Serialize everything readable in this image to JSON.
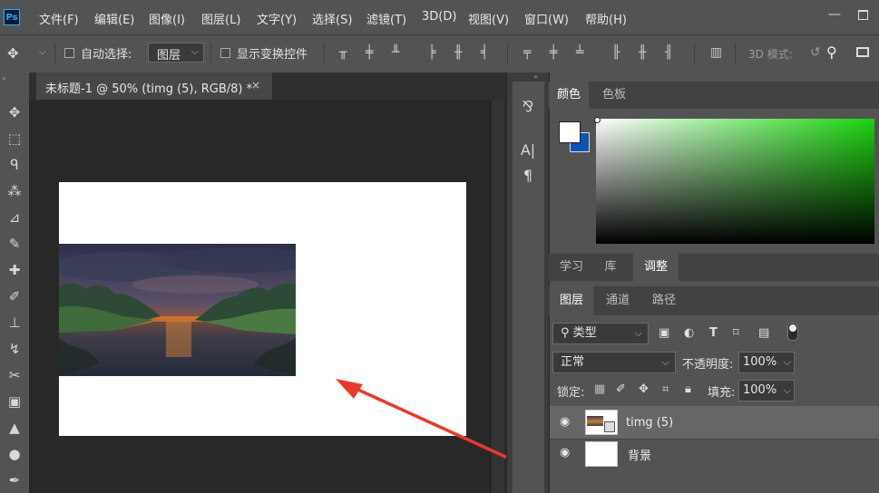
{
  "app": {
    "logo": "Ps"
  },
  "menu": [
    "文件(F)",
    "编辑(E)",
    "图像(I)",
    "图层(L)",
    "文字(Y)",
    "选择(S)",
    "滤镜(T)",
    "3D(D)",
    "视图(V)",
    "窗口(W)",
    "帮助(H)"
  ],
  "window_controls": {
    "minimize": "—"
  },
  "options_bar": {
    "auto_select_label": "自动选择:",
    "auto_select_value": "图层",
    "show_transform_label": "显示变换控件",
    "mode_3d_label": "3D 模式:"
  },
  "document": {
    "tab_title": "未标题-1 @ 50% (timg (5), RGB/8) *",
    "close": "×"
  },
  "color_panel": {
    "tabs": [
      "颜色",
      "色板"
    ],
    "foreground": "#ffffff",
    "background": "#0a54b4"
  },
  "adjust_panel": {
    "tabs": [
      "学习",
      "库",
      "调整"
    ]
  },
  "layers_panel": {
    "tabs": [
      "图层",
      "通道",
      "路径"
    ],
    "filter_label": "类型",
    "blend_mode": "正常",
    "opacity_label": "不透明度:",
    "opacity_value": "100%",
    "lock_label": "锁定:",
    "fill_label": "填充:",
    "fill_value": "100%",
    "layers": [
      {
        "name": "timg (5)",
        "selected": true
      },
      {
        "name": "背景",
        "selected": false
      }
    ]
  },
  "annotation": {
    "arrow_color": "#e8392c"
  }
}
